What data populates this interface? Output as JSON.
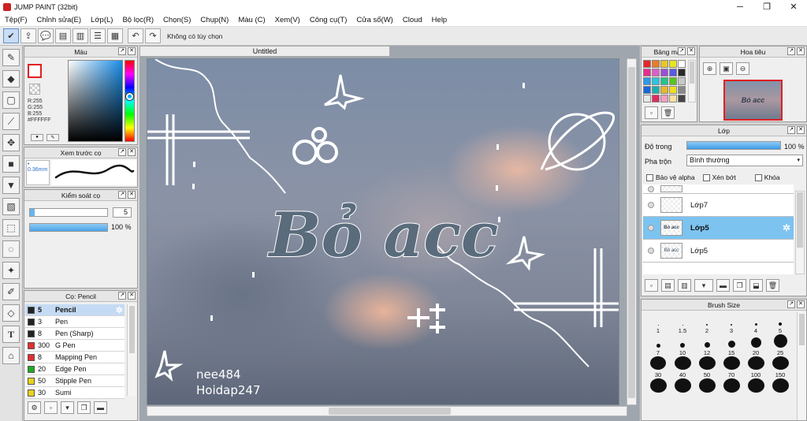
{
  "window": {
    "title": "JUMP PAINT (32bit)",
    "minimize": "─",
    "maximize": "❐",
    "close": "✕"
  },
  "menu": [
    "Tệp(F)",
    "Chỉnh sửa(E)",
    "Lớp(L)",
    "Bộ lọc(R)",
    "Chọn(S)",
    "Chụp(N)",
    "Màu (C)",
    "Xem(V)",
    "Công cụ(T)",
    "Cửa sổ(W)",
    "Cloud",
    "Help"
  ],
  "toolbar": {
    "hint": "Không có tùy chọn"
  },
  "document": {
    "tab": "Untitled"
  },
  "color_panel": {
    "title": "Màu",
    "r": "R:255",
    "g": "G:255",
    "b": "B:255",
    "hex": "#FFFFFF"
  },
  "brush_preview": {
    "title": "Xem trước cọ",
    "size": "0.36mm"
  },
  "brush_control": {
    "title": "Kiểm soát cọ",
    "size_value": "5",
    "opacity_value": "100 %",
    "opacity": 1.0
  },
  "brush_list": {
    "title": "Cọ: Pencil",
    "items": [
      {
        "size": "5",
        "name": "Pencil",
        "color": "#222222",
        "selected": true
      },
      {
        "size": "3",
        "name": "Pen",
        "color": "#222222"
      },
      {
        "size": "8",
        "name": "Pen (Sharp)",
        "color": "#222222"
      },
      {
        "size": "300",
        "name": "G Pen",
        "color": "#e03030"
      },
      {
        "size": "8",
        "name": "Mapping Pen",
        "color": "#e03030"
      },
      {
        "size": "20",
        "name": "Edge Pen",
        "color": "#22aa22"
      },
      {
        "size": "50",
        "name": "Stipple Pen",
        "color": "#e8d21a"
      },
      {
        "size": "30",
        "name": "Sumi",
        "color": "#e8d21a"
      }
    ]
  },
  "palette": {
    "title": "Bảng màu",
    "colors": [
      "#e52828",
      "#e87d28",
      "#e8c628",
      "#e6e622",
      "#ffffff",
      "#e42e8c",
      "#e05ec6",
      "#9a4ed8",
      "#5a5ae0",
      "#2a2a2a",
      "#2b9ae8",
      "#2ac4e0",
      "#24c48c",
      "#5ac424",
      "#c8c8c8",
      "#1a66d8",
      "#1ab0b0",
      "#e8b828",
      "#f0e020",
      "#888888",
      "#e8e8e8",
      "#e02a60",
      "#f0a0c0",
      "#ffe0a0",
      "#444444"
    ]
  },
  "navigator": {
    "title": "Hoa tiêu",
    "thumb_text": "Bỏ acc"
  },
  "layers": {
    "title": "Lớp",
    "opacity_label": "Độ trong",
    "opacity_value": "100 %",
    "blend_label": "Pha trộn",
    "blend_value": "Bình thường",
    "protect_alpha": "Bảo vệ alpha",
    "clipping": "Xén bớt",
    "lock": "Khóa",
    "items": [
      {
        "name": "Lớp7",
        "selected": false,
        "thumb": ""
      },
      {
        "name": "Lớp5",
        "selected": true,
        "thumb": "Bỏ acc"
      },
      {
        "name": "Lớp5",
        "selected": false,
        "thumb": "Bỏ acc"
      }
    ]
  },
  "brush_size": {
    "title": "Brush Size",
    "rows": [
      [
        {
          "l": "1",
          "d": 1
        },
        {
          "l": "1.5",
          "d": 1
        },
        {
          "l": "2",
          "d": 2
        },
        {
          "l": "3",
          "d": 2
        },
        {
          "l": "4",
          "d": 3
        },
        {
          "l": "5",
          "d": 4
        }
      ],
      [
        {
          "l": "7",
          "d": 5
        },
        {
          "l": "10",
          "d": 6
        },
        {
          "l": "12",
          "d": 7
        },
        {
          "l": "15",
          "d": 9
        },
        {
          "l": "20",
          "d": 13
        },
        {
          "l": "25",
          "d": 17
        }
      ],
      [
        {
          "l": "30",
          "d": 20
        },
        {
          "l": "40",
          "d": 21
        },
        {
          "l": "50",
          "d": 21
        },
        {
          "l": "70",
          "d": 21
        },
        {
          "l": "100",
          "d": 21
        },
        {
          "l": "150",
          "d": 21
        }
      ],
      [
        {
          "l": "",
          "d": 21
        },
        {
          "l": "",
          "d": 21
        },
        {
          "l": "",
          "d": 21
        },
        {
          "l": "",
          "d": 21
        },
        {
          "l": "",
          "d": 21
        },
        {
          "l": "",
          "d": 21
        }
      ]
    ]
  },
  "artwork": {
    "main_text": "Bỏ acc",
    "sig1": "nee484",
    "sig2": "Hoidap247"
  }
}
